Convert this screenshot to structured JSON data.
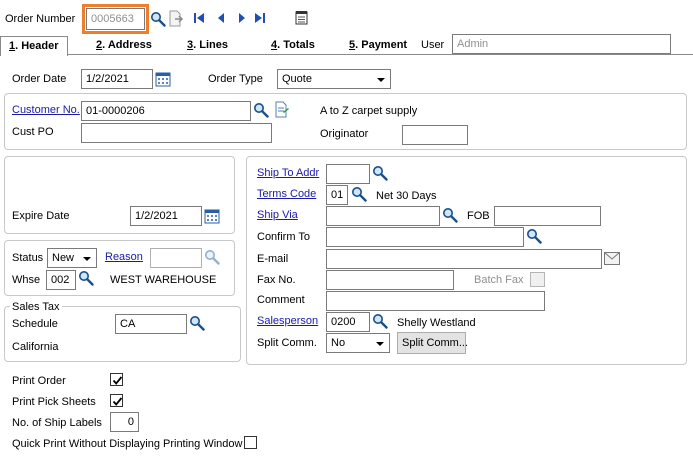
{
  "toolbar": {
    "order_number_label": "Order Number",
    "order_number_value": "0005663",
    "icons": [
      "search-icon",
      "copy-document-icon",
      "first-record-icon",
      "previous-record-icon",
      "next-record-icon",
      "last-record-icon",
      "notes-icon"
    ]
  },
  "tabs": [
    {
      "key": "1",
      "label": ". Header"
    },
    {
      "key": "2",
      "label": ". Address"
    },
    {
      "key": "3",
      "label": ". Lines"
    },
    {
      "key": "4",
      "label": ". Totals"
    },
    {
      "key": "5",
      "label": ". Payment"
    }
  ],
  "user": {
    "label": "User",
    "placeholder": "Admin"
  },
  "header": {
    "order_date_label": "Order Date",
    "order_date": "1/2/2021",
    "order_type_label": "Order Type",
    "order_type": "Quote",
    "customer_no_label": "Customer No.",
    "customer_no": "01-0000206",
    "customer_name": "A to Z carpet supply",
    "cust_po_label": "Cust PO",
    "cust_po": "",
    "originator_label": "Originator",
    "originator": ""
  },
  "left": {
    "expire_date_label": "Expire Date",
    "expire_date": "1/2/2021",
    "status_label": "Status",
    "status": "New",
    "reason_label": "Reason",
    "reason": "",
    "whse_label": "Whse",
    "whse": "002",
    "whse_name": "WEST WAREHOUSE",
    "sales_tax_label": "Sales Tax",
    "schedule_label": "Schedule",
    "schedule": "CA",
    "schedule_desc": "California"
  },
  "right": {
    "ship_to_addr_label": "Ship To Addr",
    "ship_to_addr": "",
    "terms_code_label": "Terms Code",
    "terms_code": "01",
    "terms_desc": "Net 30 Days",
    "ship_via_label": "Ship Via",
    "ship_via": "",
    "fob_label": "FOB",
    "fob": "",
    "confirm_to_label": "Confirm To",
    "confirm_to": "",
    "email_label": "E-mail",
    "email": "",
    "fax_label": "Fax No.",
    "fax": "",
    "batch_fax_label": "Batch Fax",
    "batch_fax": false,
    "comment_label": "Comment",
    "comment": "",
    "salesperson_label": "Salesperson",
    "salesperson": "0200",
    "salesperson_name": "Shelly Westland",
    "split_comm_label": "Split Comm.",
    "split_comm": "No",
    "split_comm_button": "Split Comm..."
  },
  "bottom": {
    "print_order_label": "Print Order",
    "print_order": true,
    "print_pick_label": "Print Pick Sheets",
    "print_pick": true,
    "ship_labels_label": "No. of Ship Labels",
    "ship_labels": "0",
    "quick_print_label": "Quick Print Without Displaying Printing Window",
    "quick_print": false
  },
  "colors": {
    "highlight": "#f07d2a",
    "link": "#1a1aa8",
    "nav": "#1f4fb5"
  }
}
